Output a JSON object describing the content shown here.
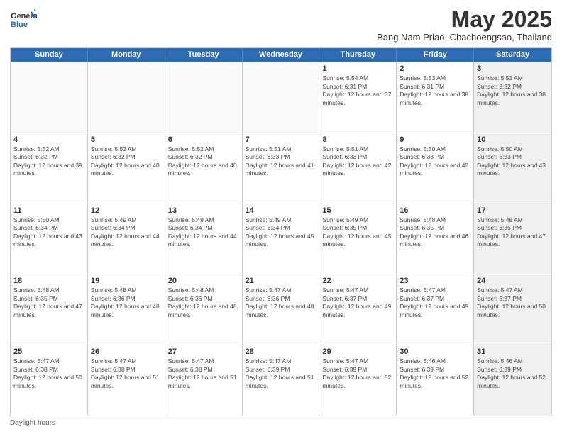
{
  "logo": {
    "general": "General",
    "blue": "Blue"
  },
  "header": {
    "month": "May 2025",
    "location": "Bang Nam Priao, Chachoengsao, Thailand"
  },
  "weekdays": [
    "Sunday",
    "Monday",
    "Tuesday",
    "Wednesday",
    "Thursday",
    "Friday",
    "Saturday"
  ],
  "weeks": [
    [
      {
        "day": "",
        "sunrise": "",
        "sunset": "",
        "daylight": "",
        "empty": true
      },
      {
        "day": "",
        "sunrise": "",
        "sunset": "",
        "daylight": "",
        "empty": true
      },
      {
        "day": "",
        "sunrise": "",
        "sunset": "",
        "daylight": "",
        "empty": true
      },
      {
        "day": "",
        "sunrise": "",
        "sunset": "",
        "daylight": "",
        "empty": true
      },
      {
        "day": "1",
        "sunrise": "Sunrise: 5:54 AM",
        "sunset": "Sunset: 6:31 PM",
        "daylight": "Daylight: 12 hours and 37 minutes.",
        "empty": false
      },
      {
        "day": "2",
        "sunrise": "Sunrise: 5:53 AM",
        "sunset": "Sunset: 6:31 PM",
        "daylight": "Daylight: 12 hours and 38 minutes.",
        "empty": false
      },
      {
        "day": "3",
        "sunrise": "Sunrise: 5:53 AM",
        "sunset": "Sunset: 6:32 PM",
        "daylight": "Daylight: 12 hours and 38 minutes.",
        "empty": false,
        "shaded": true
      }
    ],
    [
      {
        "day": "4",
        "sunrise": "Sunrise: 5:52 AM",
        "sunset": "Sunset: 6:32 PM",
        "daylight": "Daylight: 12 hours and 39 minutes.",
        "empty": false
      },
      {
        "day": "5",
        "sunrise": "Sunrise: 5:52 AM",
        "sunset": "Sunset: 6:32 PM",
        "daylight": "Daylight: 12 hours and 40 minutes.",
        "empty": false
      },
      {
        "day": "6",
        "sunrise": "Sunrise: 5:52 AM",
        "sunset": "Sunset: 6:32 PM",
        "daylight": "Daylight: 12 hours and 40 minutes.",
        "empty": false
      },
      {
        "day": "7",
        "sunrise": "Sunrise: 5:51 AM",
        "sunset": "Sunset: 6:33 PM",
        "daylight": "Daylight: 12 hours and 41 minutes.",
        "empty": false
      },
      {
        "day": "8",
        "sunrise": "Sunrise: 5:51 AM",
        "sunset": "Sunset: 6:33 PM",
        "daylight": "Daylight: 12 hours and 42 minutes.",
        "empty": false
      },
      {
        "day": "9",
        "sunrise": "Sunrise: 5:50 AM",
        "sunset": "Sunset: 6:33 PM",
        "daylight": "Daylight: 12 hours and 42 minutes.",
        "empty": false
      },
      {
        "day": "10",
        "sunrise": "Sunrise: 5:50 AM",
        "sunset": "Sunset: 6:33 PM",
        "daylight": "Daylight: 12 hours and 43 minutes.",
        "empty": false,
        "shaded": true
      }
    ],
    [
      {
        "day": "11",
        "sunrise": "Sunrise: 5:50 AM",
        "sunset": "Sunset: 6:34 PM",
        "daylight": "Daylight: 12 hours and 43 minutes.",
        "empty": false
      },
      {
        "day": "12",
        "sunrise": "Sunrise: 5:49 AM",
        "sunset": "Sunset: 6:34 PM",
        "daylight": "Daylight: 12 hours and 44 minutes.",
        "empty": false
      },
      {
        "day": "13",
        "sunrise": "Sunrise: 5:49 AM",
        "sunset": "Sunset: 6:34 PM",
        "daylight": "Daylight: 12 hours and 44 minutes.",
        "empty": false
      },
      {
        "day": "14",
        "sunrise": "Sunrise: 5:49 AM",
        "sunset": "Sunset: 6:34 PM",
        "daylight": "Daylight: 12 hours and 45 minutes.",
        "empty": false
      },
      {
        "day": "15",
        "sunrise": "Sunrise: 5:49 AM",
        "sunset": "Sunset: 6:35 PM",
        "daylight": "Daylight: 12 hours and 45 minutes.",
        "empty": false
      },
      {
        "day": "16",
        "sunrise": "Sunrise: 5:48 AM",
        "sunset": "Sunset: 6:35 PM",
        "daylight": "Daylight: 12 hours and 46 minutes.",
        "empty": false
      },
      {
        "day": "17",
        "sunrise": "Sunrise: 5:48 AM",
        "sunset": "Sunset: 6:35 PM",
        "daylight": "Daylight: 12 hours and 47 minutes.",
        "empty": false,
        "shaded": true
      }
    ],
    [
      {
        "day": "18",
        "sunrise": "Sunrise: 5:48 AM",
        "sunset": "Sunset: 6:35 PM",
        "daylight": "Daylight: 12 hours and 47 minutes.",
        "empty": false
      },
      {
        "day": "19",
        "sunrise": "Sunrise: 5:48 AM",
        "sunset": "Sunset: 6:36 PM",
        "daylight": "Daylight: 12 hours and 48 minutes.",
        "empty": false
      },
      {
        "day": "20",
        "sunrise": "Sunrise: 5:48 AM",
        "sunset": "Sunset: 6:36 PM",
        "daylight": "Daylight: 12 hours and 48 minutes.",
        "empty": false
      },
      {
        "day": "21",
        "sunrise": "Sunrise: 5:47 AM",
        "sunset": "Sunset: 6:36 PM",
        "daylight": "Daylight: 12 hours and 48 minutes.",
        "empty": false
      },
      {
        "day": "22",
        "sunrise": "Sunrise: 5:47 AM",
        "sunset": "Sunset: 6:37 PM",
        "daylight": "Daylight: 12 hours and 49 minutes.",
        "empty": false
      },
      {
        "day": "23",
        "sunrise": "Sunrise: 5:47 AM",
        "sunset": "Sunset: 6:37 PM",
        "daylight": "Daylight: 12 hours and 49 minutes.",
        "empty": false
      },
      {
        "day": "24",
        "sunrise": "Sunrise: 5:47 AM",
        "sunset": "Sunset: 6:37 PM",
        "daylight": "Daylight: 12 hours and 50 minutes.",
        "empty": false,
        "shaded": true
      }
    ],
    [
      {
        "day": "25",
        "sunrise": "Sunrise: 5:47 AM",
        "sunset": "Sunset: 6:38 PM",
        "daylight": "Daylight: 12 hours and 50 minutes.",
        "empty": false
      },
      {
        "day": "26",
        "sunrise": "Sunrise: 5:47 AM",
        "sunset": "Sunset: 6:38 PM",
        "daylight": "Daylight: 12 hours and 51 minutes.",
        "empty": false
      },
      {
        "day": "27",
        "sunrise": "Sunrise: 5:47 AM",
        "sunset": "Sunset: 6:38 PM",
        "daylight": "Daylight: 12 hours and 51 minutes.",
        "empty": false
      },
      {
        "day": "28",
        "sunrise": "Sunrise: 5:47 AM",
        "sunset": "Sunset: 6:39 PM",
        "daylight": "Daylight: 12 hours and 51 minutes.",
        "empty": false
      },
      {
        "day": "29",
        "sunrise": "Sunrise: 5:47 AM",
        "sunset": "Sunset: 6:39 PM",
        "daylight": "Daylight: 12 hours and 52 minutes.",
        "empty": false
      },
      {
        "day": "30",
        "sunrise": "Sunrise: 5:46 AM",
        "sunset": "Sunset: 6:39 PM",
        "daylight": "Daylight: 12 hours and 52 minutes.",
        "empty": false
      },
      {
        "day": "31",
        "sunrise": "Sunrise: 5:46 AM",
        "sunset": "Sunset: 6:39 PM",
        "daylight": "Daylight: 12 hours and 52 minutes.",
        "empty": false,
        "shaded": true
      }
    ]
  ],
  "footer": {
    "note": "Daylight hours"
  }
}
